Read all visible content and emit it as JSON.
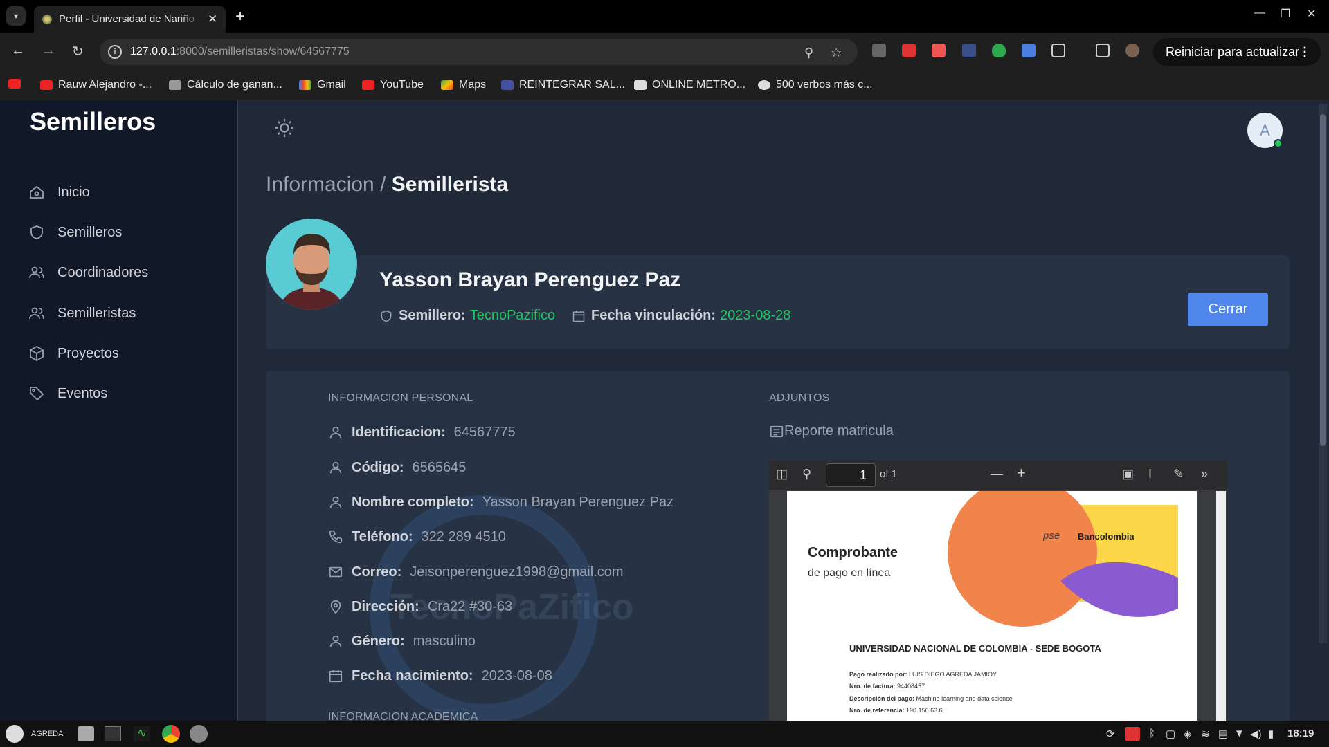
{
  "browser": {
    "tab_title": "Perfil - Universidad de Nariño",
    "url_host": "127.0.0.1",
    "url_path": ":8000/semilleristas/show/64567775",
    "update_label": "Reiniciar para actualizar",
    "bookmarks": [
      "",
      "Rauw Alejandro -...",
      "Cálculo de ganan...",
      "Gmail",
      "YouTube",
      "Maps",
      "REINTEGRAR SAL...",
      "ONLINE METRO...",
      "500 verbos más c..."
    ]
  },
  "sidebar": {
    "brand": "Semilleros",
    "items": [
      "Inicio",
      "Semilleros",
      "Coordinadores",
      "Semilleristas",
      "Proyectos",
      "Eventos"
    ]
  },
  "header": {
    "avatar_letter": "A",
    "crumb_parent": "Informacion /",
    "crumb_current": "Semillerista"
  },
  "profile": {
    "name": "Yasson Brayan Perenguez Paz",
    "semillero_label": "Semillero:",
    "semillero_value": "TecnoPazifico",
    "fecha_label": "Fecha vinculación:",
    "fecha_value": "2023-08-28",
    "close_label": "Cerrar"
  },
  "personal": {
    "heading": "INFORMACION PERSONAL",
    "fields": [
      {
        "k": "Identificacion:",
        "v": "64567775",
        "icon": "user-icon"
      },
      {
        "k": "Código:",
        "v": "6565645",
        "icon": "user-icon"
      },
      {
        "k": "Nombre completo:",
        "v": "Yasson Brayan Perenguez Paz",
        "icon": "user-icon"
      },
      {
        "k": "Teléfono:",
        "v": "322 289 4510",
        "icon": "phone-icon"
      },
      {
        "k": "Correo:",
        "v": "Jeisonperenguez1998@gmail.com",
        "icon": "mail-icon"
      },
      {
        "k": "Dirección:",
        "v": "Cra22 #30-63",
        "icon": "location-icon"
      },
      {
        "k": "Género:",
        "v": "masculino",
        "icon": "user-icon"
      },
      {
        "k": "Fecha nacimiento:",
        "v": "2023-08-08",
        "icon": "calendar-icon"
      }
    ],
    "academic_heading": "INFORMACION ACADEMICA",
    "watermark": "TecnoPaZifico"
  },
  "attachments": {
    "heading": "ADJUNTOS",
    "doc_title": "Reporte matricula",
    "pdf_page": "1",
    "pdf_of": "of 1",
    "doc": {
      "title": "Comprobante",
      "subtitle": "de pago en línea",
      "pse": "pse",
      "bank": "Bancolombia",
      "university": "UNIVERSIDAD NACIONAL DE COLOMBIA - SEDE BOGOTA",
      "lines": [
        {
          "k": "Pago realizado por:",
          "v": "LUIS DIEGO AGREDA JAMIOY"
        },
        {
          "k": "Nro. de factura:",
          "v": "94408457"
        },
        {
          "k": "Descripción del pago:",
          "v": "Machine learning and data science"
        },
        {
          "k": "Nro. de referencia:",
          "v": "190.156.63.6"
        }
      ]
    }
  },
  "taskbar": {
    "user": "AGREDA",
    "clock": "18:19"
  },
  "colors": {
    "accent": "#4f86ec",
    "success": "#22c55e",
    "page_bg": "#1f2937",
    "sidebar_bg": "#111827",
    "card_bg": "#273244"
  }
}
